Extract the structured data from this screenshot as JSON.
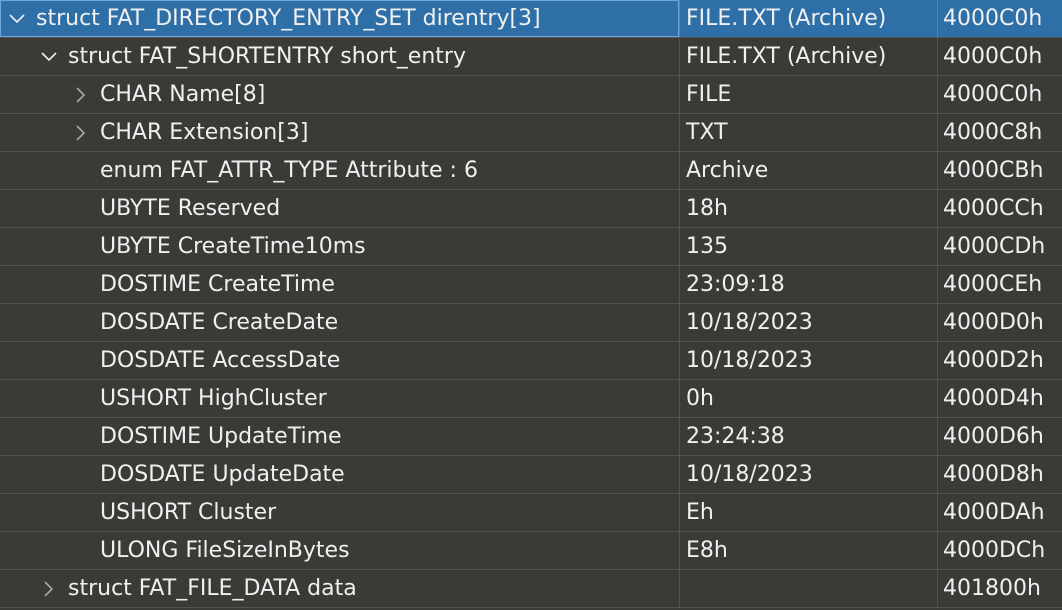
{
  "rows": [
    {
      "name": "struct FAT_DIRECTORY_ENTRY_SET direntry[3]",
      "value": "FILE.TXT (Archive)",
      "address": "4000C0h"
    },
    {
      "name": "struct FAT_SHORTENTRY short_entry",
      "value": "FILE.TXT (Archive)",
      "address": "4000C0h"
    },
    {
      "name": "CHAR Name[8]",
      "value": "FILE",
      "address": "4000C0h"
    },
    {
      "name": "CHAR Extension[3]",
      "value": "TXT",
      "address": "4000C8h"
    },
    {
      "name": "enum FAT_ATTR_TYPE Attribute : 6",
      "value": "Archive",
      "address": "4000CBh"
    },
    {
      "name": "UBYTE Reserved",
      "value": "18h",
      "address": "4000CCh"
    },
    {
      "name": "UBYTE CreateTime10ms",
      "value": "135",
      "address": "4000CDh"
    },
    {
      "name": "DOSTIME CreateTime",
      "value": "23:09:18",
      "address": "4000CEh"
    },
    {
      "name": "DOSDATE CreateDate",
      "value": "10/18/2023",
      "address": "4000D0h"
    },
    {
      "name": "DOSDATE AccessDate",
      "value": "10/18/2023",
      "address": "4000D2h"
    },
    {
      "name": "USHORT HighCluster",
      "value": "0h",
      "address": "4000D4h"
    },
    {
      "name": "DOSTIME UpdateTime",
      "value": "23:24:38",
      "address": "4000D6h"
    },
    {
      "name": "DOSDATE UpdateDate",
      "value": "10/18/2023",
      "address": "4000D8h"
    },
    {
      "name": "USHORT Cluster",
      "value": "Eh",
      "address": "4000DAh"
    },
    {
      "name": "ULONG FileSizeInBytes",
      "value": "E8h",
      "address": "4000DCh"
    },
    {
      "name": "struct FAT_FILE_DATA data",
      "value": "",
      "address": "401800h"
    }
  ],
  "icons": {
    "expanded": "chevron-down-icon",
    "collapsed": "chevron-right-icon"
  },
  "colors": {
    "background": "#3b3a37",
    "selection": "#2f6fa8",
    "text": "#f0f0f0",
    "grid": "#55534f"
  }
}
